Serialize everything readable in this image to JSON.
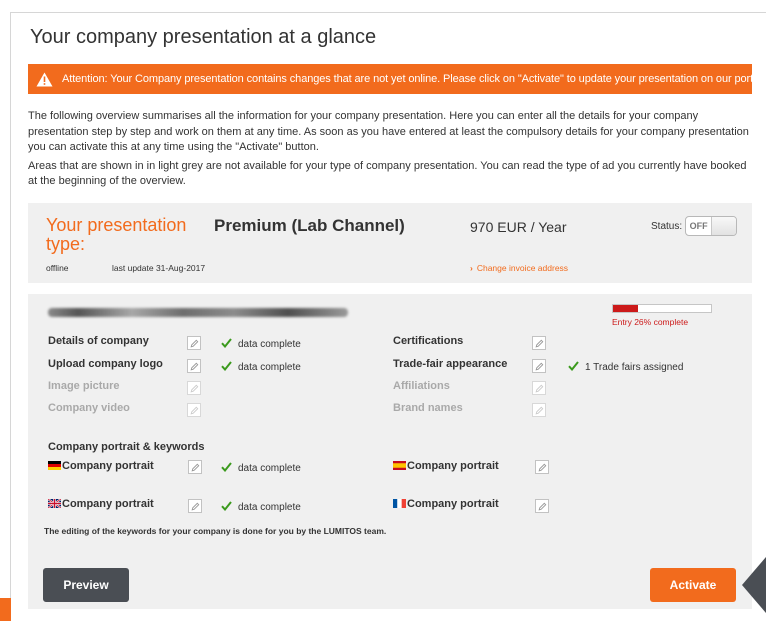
{
  "title": "Your company presentation at a glance",
  "alert": {
    "icon": "warning-icon",
    "text": "Attention: Your Company presentation contains changes that are not yet online. Please click on \"Activate\" to update your presentation on our portals.",
    "color": "#f26b1d"
  },
  "intro": {
    "p1": "The following overview summarises all the information for your company presentation. Here you can enter all the details for your company presentation step by step and work on them at any time. As soon as you have entered at least the compulsory details for your company presentation you can activate this at any time using the \"Activate\" button.",
    "p2": "Areas that are shown in in light grey are not available for your type of company presentation. You can read the type of ad you currently have booked at the beginning of the overview."
  },
  "presentation": {
    "label": "Your presentation type:",
    "type": "Premium (Lab Channel)",
    "price": "970 EUR / Year",
    "status_label": "Status:",
    "status_toggle": "OFF",
    "online_state": "offline",
    "last_update": "last update 31-Aug-2017",
    "invoice_link": "Change invoice address"
  },
  "progress": {
    "percent": 26,
    "label": "Entry 26% complete",
    "color": "#cc1a1a"
  },
  "details": {
    "details_of_company": "Details of company",
    "upload_logo": "Upload company logo",
    "image_picture": "Image picture",
    "company_video": "Company video",
    "certifications": "Certifications",
    "trade_fair": "Trade-fair appearance",
    "affiliations": "Affiliations",
    "brand_names": "Brand names",
    "data_complete": "data complete",
    "trade_fairs_assigned": "1 Trade fairs assigned"
  },
  "portrait": {
    "heading": "Company portrait & keywords",
    "de": "Company portrait",
    "es": "Company portrait",
    "uk": "Company portrait",
    "fr": "Company portrait",
    "data_complete": "data complete",
    "note": "The editing of the keywords for your company is done for you by the LUMITOS team."
  },
  "buttons": {
    "preview": "Preview",
    "activate": "Activate"
  }
}
